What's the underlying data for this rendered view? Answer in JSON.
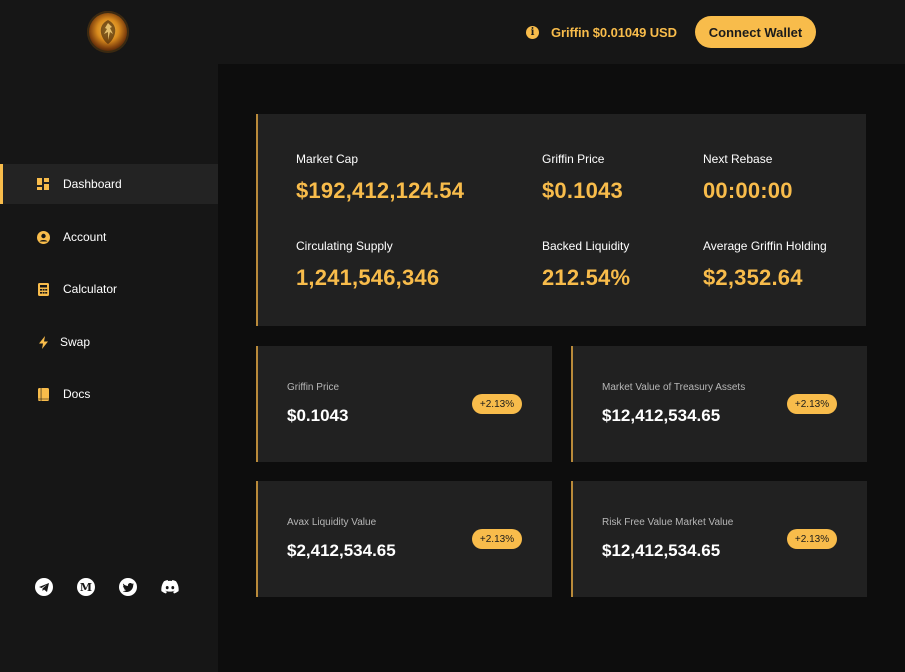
{
  "header": {
    "price_text": "Griffin $0.01049 USD",
    "connect_label": "Connect Wallet"
  },
  "sidebar": {
    "items": [
      {
        "label": "Dashboard",
        "icon": "grid-icon",
        "active": true
      },
      {
        "label": "Account",
        "icon": "user-circle-icon",
        "active": false
      },
      {
        "label": "Calculator",
        "icon": "calculator-icon",
        "active": false
      },
      {
        "label": "Swap",
        "icon": "lightning-icon",
        "active": false
      },
      {
        "label": "Docs",
        "icon": "book-icon",
        "active": false
      }
    ],
    "socials": [
      {
        "icon": "telegram-icon"
      },
      {
        "icon": "medium-icon",
        "glyph": "M"
      },
      {
        "icon": "twitter-icon"
      },
      {
        "icon": "discord-icon"
      }
    ]
  },
  "stats": {
    "market_cap": {
      "label": "Market Cap",
      "value": "$192,412,124.54"
    },
    "griffin_price": {
      "label": "Griffin Price",
      "value": "$0.1043"
    },
    "next_rebase": {
      "label": "Next Rebase",
      "value": "00:00:00"
    },
    "circulating_supply": {
      "label": "Circulating Supply",
      "value": "1,241,546,346"
    },
    "backed_liquidity": {
      "label": "Backed Liquidity",
      "value": "212.54%"
    },
    "avg_holding": {
      "label": "Average Griffin Holding",
      "value": "$2,352.64"
    }
  },
  "cards": [
    {
      "label": "Griffin Price",
      "value": "$0.1043",
      "badge": "+2.13%"
    },
    {
      "label": "Market Value of Treasury Assets",
      "value": "$12,412,534.65",
      "badge": "+2.13%"
    },
    {
      "label": "Avax Liquidity Value",
      "value": "$2,412,534.65",
      "badge": "+2.13%"
    },
    {
      "label": "Risk Free Value Market Value",
      "value": "$12,412,534.65",
      "badge": "+2.13%"
    }
  ],
  "colors": {
    "accent": "#f8bc4b",
    "background": "#161616",
    "main_bg": "#0d0d0d",
    "panel_bg": "#212121",
    "border_accent": "#b98a3a"
  }
}
